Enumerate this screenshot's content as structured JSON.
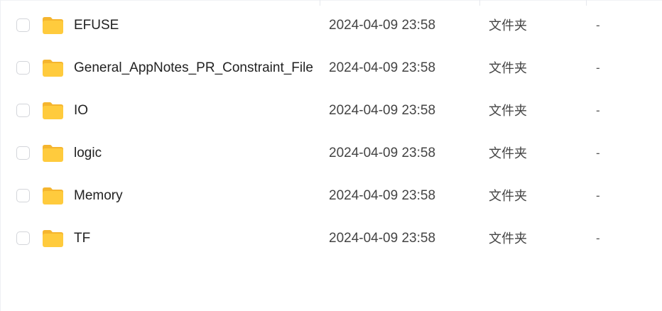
{
  "file_list": {
    "rows": [
      {
        "name": "EFUSE",
        "modified": "2024-04-09 23:58",
        "type": "文件夹",
        "size": "-"
      },
      {
        "name": "General_AppNotes_PR_Constraint_File",
        "modified": "2024-04-09 23:58",
        "type": "文件夹",
        "size": "-"
      },
      {
        "name": "IO",
        "modified": "2024-04-09 23:58",
        "type": "文件夹",
        "size": "-"
      },
      {
        "name": "logic",
        "modified": "2024-04-09 23:58",
        "type": "文件夹",
        "size": "-"
      },
      {
        "name": "Memory",
        "modified": "2024-04-09 23:58",
        "type": "文件夹",
        "size": "-"
      },
      {
        "name": "TF",
        "modified": "2024-04-09 23:58",
        "type": "文件夹",
        "size": "-"
      }
    ]
  },
  "icons": {
    "row_icon": "folder-icon",
    "select": "checkbox"
  },
  "colors": {
    "folder_body": "#FFCB3D",
    "folder_tab": "#F5B52E",
    "checkbox_border": "#D3D5DA"
  }
}
